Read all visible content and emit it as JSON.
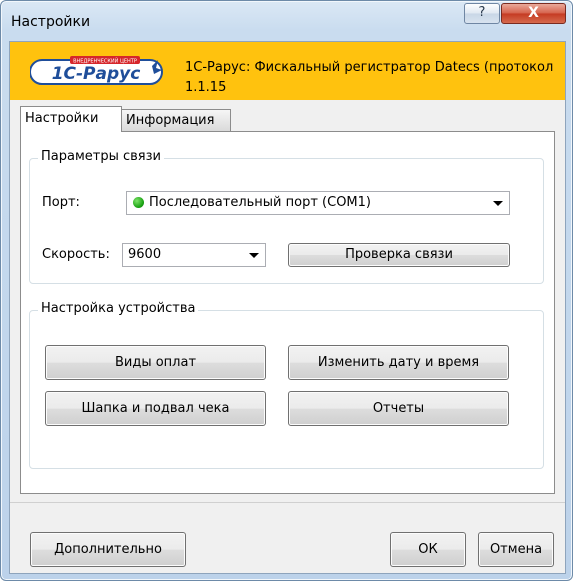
{
  "window": {
    "title": "Настройки",
    "help_glyph": "?",
    "close_glyph": "X"
  },
  "banner": {
    "logo_text": "1С-Рарус",
    "logo_small_text": "ВНЕДРЕНЧЕСКИЙ ЦЕНТР",
    "text": "1С-Рарус: Фискальный регистратор Datecs (протокол 1.1.15",
    "color": "#ffc20e"
  },
  "tabs": [
    {
      "label": "Настройки",
      "active": true
    },
    {
      "label": "Информация",
      "active": false
    }
  ],
  "connection": {
    "group_title": "Параметры связи",
    "port_label": "Порт:",
    "port_value": "Последовательный порт (COM1)",
    "speed_label": "Скорость:",
    "speed_value": "9600",
    "check_button": "Проверка связи",
    "status_color": "#19a212"
  },
  "device": {
    "group_title": "Настройка устройства",
    "payment_types_button": "Виды оплат",
    "change_datetime_button": "Изменить дату и время",
    "header_footer_button": "Шапка и подвал чека",
    "reports_button": "Отчеты"
  },
  "footer": {
    "advanced_button": "Дополнительно",
    "ok_button": "ОК",
    "cancel_button": "Отмена"
  }
}
